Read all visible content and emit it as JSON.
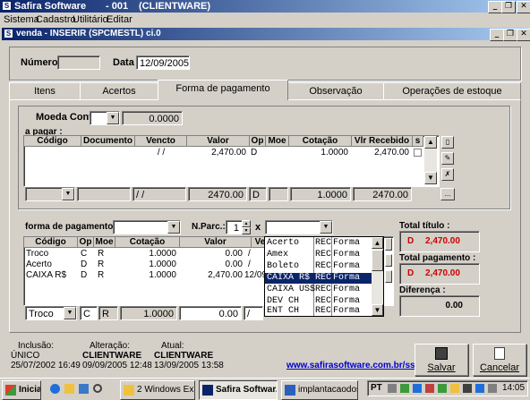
{
  "app": {
    "title": "Safira Software",
    "subtitle": "- 001",
    "client": "(CLIENTWARE)"
  },
  "menu": [
    "Sistema",
    "Cadastro",
    "Utilitário",
    "Editar"
  ],
  "child_window": {
    "title": "venda - INSERIR (SPCMESTL) ci.0"
  },
  "header": {
    "numero_label": "Número :",
    "numero_value": "",
    "data_label": "Data :",
    "data_value": "12/09/2005"
  },
  "tabs": [
    "Itens",
    "Acertos",
    "Forma de pagamento",
    "Observação",
    "Operações de estoque"
  ],
  "moeda": {
    "label": "Moeda Conv.:",
    "value": "",
    "rate": "0.0000"
  },
  "a_pagar": {
    "label": "a pagar :",
    "columns": [
      "Código",
      "Documento",
      "Vencto",
      "Valor",
      "Op",
      "Moe",
      "Cotação",
      "Vlr Recebido",
      "s"
    ],
    "rows": [
      {
        "codigo": "",
        "documento": "",
        "vencto": "/  /",
        "valor": "2,470.00",
        "op": "D",
        "moe": "",
        "cotacao": "1.0000",
        "vlr_recebido": "2,470.00",
        "s": ""
      }
    ],
    "edit_row": {
      "vencto": "/  /",
      "valor": "2470.00",
      "op": "D",
      "cotacao": "1.0000",
      "vlr_recebido": "2470.00"
    }
  },
  "forma_pagamento": {
    "label": "forma de pagamento :",
    "value": "",
    "nparc_label": "N.Parc.:",
    "nparc_value": "1",
    "x_label": "x",
    "x_value": ""
  },
  "payments": {
    "columns": [
      "Código",
      "Op",
      "Moe",
      "Cotação",
      "Valor",
      "Ve"
    ],
    "rows": [
      {
        "codigo": "Troco",
        "op": "C",
        "moe": "R",
        "cotacao": "1.0000",
        "valor": "0.00",
        "ve": "/"
      },
      {
        "codigo": "Acerto",
        "op": "D",
        "moe": "R",
        "cotacao": "1.0000",
        "valor": "0.00",
        "ve": "/"
      },
      {
        "codigo": "CAIXA R$",
        "op": "D",
        "moe": "R",
        "cotacao": "1.0000",
        "valor": "2,470.00",
        "ve": "12/09"
      }
    ],
    "edit_row": {
      "codigo": "Troco",
      "op": "C",
      "moe": "R",
      "cotacao": "1.0000",
      "valor": "0.00",
      "ve": "/"
    }
  },
  "dropdown": {
    "items": [
      {
        "code": "Acerto",
        "type": "REC",
        "desc": "Forma"
      },
      {
        "code": "Amex",
        "type": "REC",
        "desc": "Forma"
      },
      {
        "code": "Boleto",
        "type": "REC",
        "desc": "Forma"
      },
      {
        "code": "CAIXA R$",
        "type": "REC",
        "desc": "Forma"
      },
      {
        "code": "CAIXA US$",
        "type": "REC",
        "desc": "Forma"
      },
      {
        "code": "DEV CH",
        "type": "REC",
        "desc": "Forma"
      },
      {
        "code": "ENT CH",
        "type": "REC",
        "desc": "Forma"
      }
    ],
    "selected_index": 3
  },
  "totals": {
    "total_titulo_label": "Total título :",
    "total_titulo_prefix": "D",
    "total_titulo_value": "2,470.00",
    "total_pagamento_label": "Total pagamento :",
    "total_pagamento_prefix": "D",
    "total_pagamento_value": "2,470.00",
    "diferenca_label": "Diferença :",
    "diferenca_value": "0.00"
  },
  "footer": {
    "inclusao_label": "Inclusão:",
    "inclusao_user": "ÚNICO",
    "inclusao_date": "25/07/2002 16:49",
    "alteracao_label": "Alteração:",
    "alteracao_user": "CLIENTWARE",
    "alteracao_date": "09/09/2005 12:48",
    "atual_label": "Atual:",
    "atual_user": "CLIENTWARE",
    "atual_date": "13/09/2005 13:58",
    "website": "www.safirasoftware.com.br/ss",
    "salvar": "Salvar",
    "cancelar": "Cancelar"
  },
  "taskbar": {
    "start": "Iniciar",
    "buttons": [
      "2 Windows Ex...",
      "Safira Softwar...",
      "implantacaodosi..."
    ],
    "lang": "PT",
    "clock": "14:05"
  },
  "colors": {
    "title_start": "#0a246a",
    "title_end": "#a6caf0",
    "total_red": "#cc0000",
    "selection": "#0a246a",
    "link": "#0000cc",
    "taskbar": "#245edb",
    "start": "#3c9a3c"
  }
}
